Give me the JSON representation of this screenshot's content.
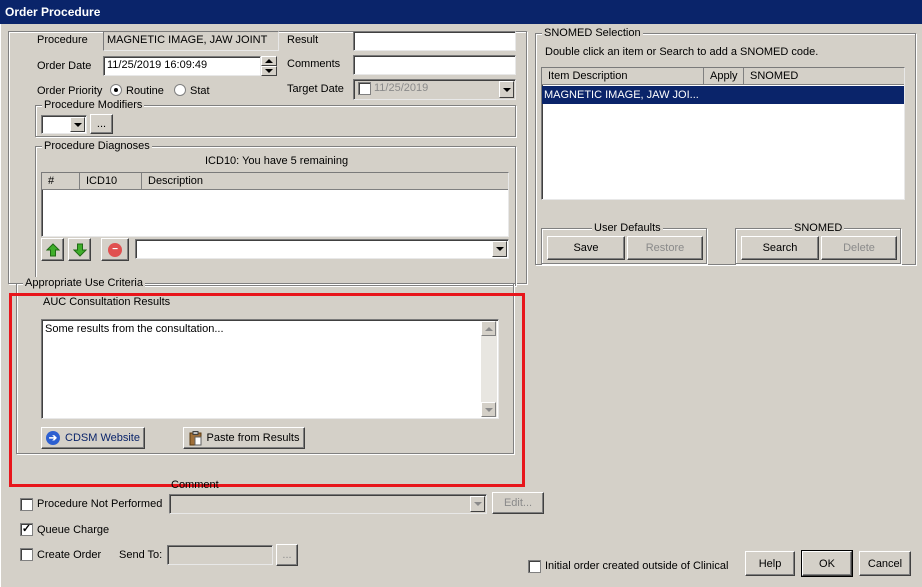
{
  "window": {
    "title": "Order Procedure"
  },
  "procedure": {
    "label": "Procedure",
    "value": "MAGNETIC IMAGE, JAW JOINT",
    "order_date_label": "Order Date",
    "order_date_value": "11/25/2019 16:09:49",
    "order_priority_label": "Order Priority",
    "priority_options": [
      "Routine",
      "Stat"
    ],
    "priority_selected": "Routine",
    "result_label": "Result",
    "result_value": "",
    "comments_label": "Comments",
    "comments_value": "",
    "target_date_label": "Target Date",
    "target_date_value": "11/25/2019"
  },
  "modifiers": {
    "title": "Procedure Modifiers",
    "browse_label": "..."
  },
  "diagnoses": {
    "title": "Procedure Diagnoses",
    "status": "ICD10: You have 5 remaining",
    "columns": [
      "#",
      "ICD10",
      "Description"
    ],
    "rows": []
  },
  "auc": {
    "title": "Appropriate Use Criteria",
    "results_label": "AUC Consultation Results",
    "results_text": "Some results from the consultation...",
    "cdsm_button": "CDSM Website",
    "paste_button": "Paste from Results"
  },
  "snomed": {
    "title": "SNOMED Selection",
    "hint": "Double click an item or Search to add a SNOMED code.",
    "columns": [
      "Item Description",
      "Apply",
      "SNOMED"
    ],
    "rows": [
      {
        "description": "MAGNETIC IMAGE, JAW JOI...",
        "apply": "",
        "snomed": ""
      }
    ],
    "user_defaults_title": "User Defaults",
    "save_button": "Save",
    "restore_button": "Restore",
    "snomed_group_title": "SNOMED",
    "search_button": "Search",
    "delete_button": "Delete"
  },
  "bottom": {
    "comment_label": "Comment",
    "procedure_not_performed_label": "Procedure Not Performed",
    "procedure_not_performed_checked": false,
    "edit_button": "Edit...",
    "queue_charge_label": "Queue Charge",
    "queue_charge_checked": true,
    "create_order_label": "Create Order",
    "create_order_checked": false,
    "send_to_label": "Send To:",
    "send_to_browse": "...",
    "initial_order_label": "Initial order created outside of Clinical",
    "initial_order_checked": false,
    "help_button": "Help",
    "ok_button": "OK",
    "cancel_button": "Cancel"
  },
  "colors": {
    "titlebar": "#0a246a",
    "selection": "#0a246a",
    "highlight": "#e8151b",
    "face": "#d4d0c8"
  }
}
